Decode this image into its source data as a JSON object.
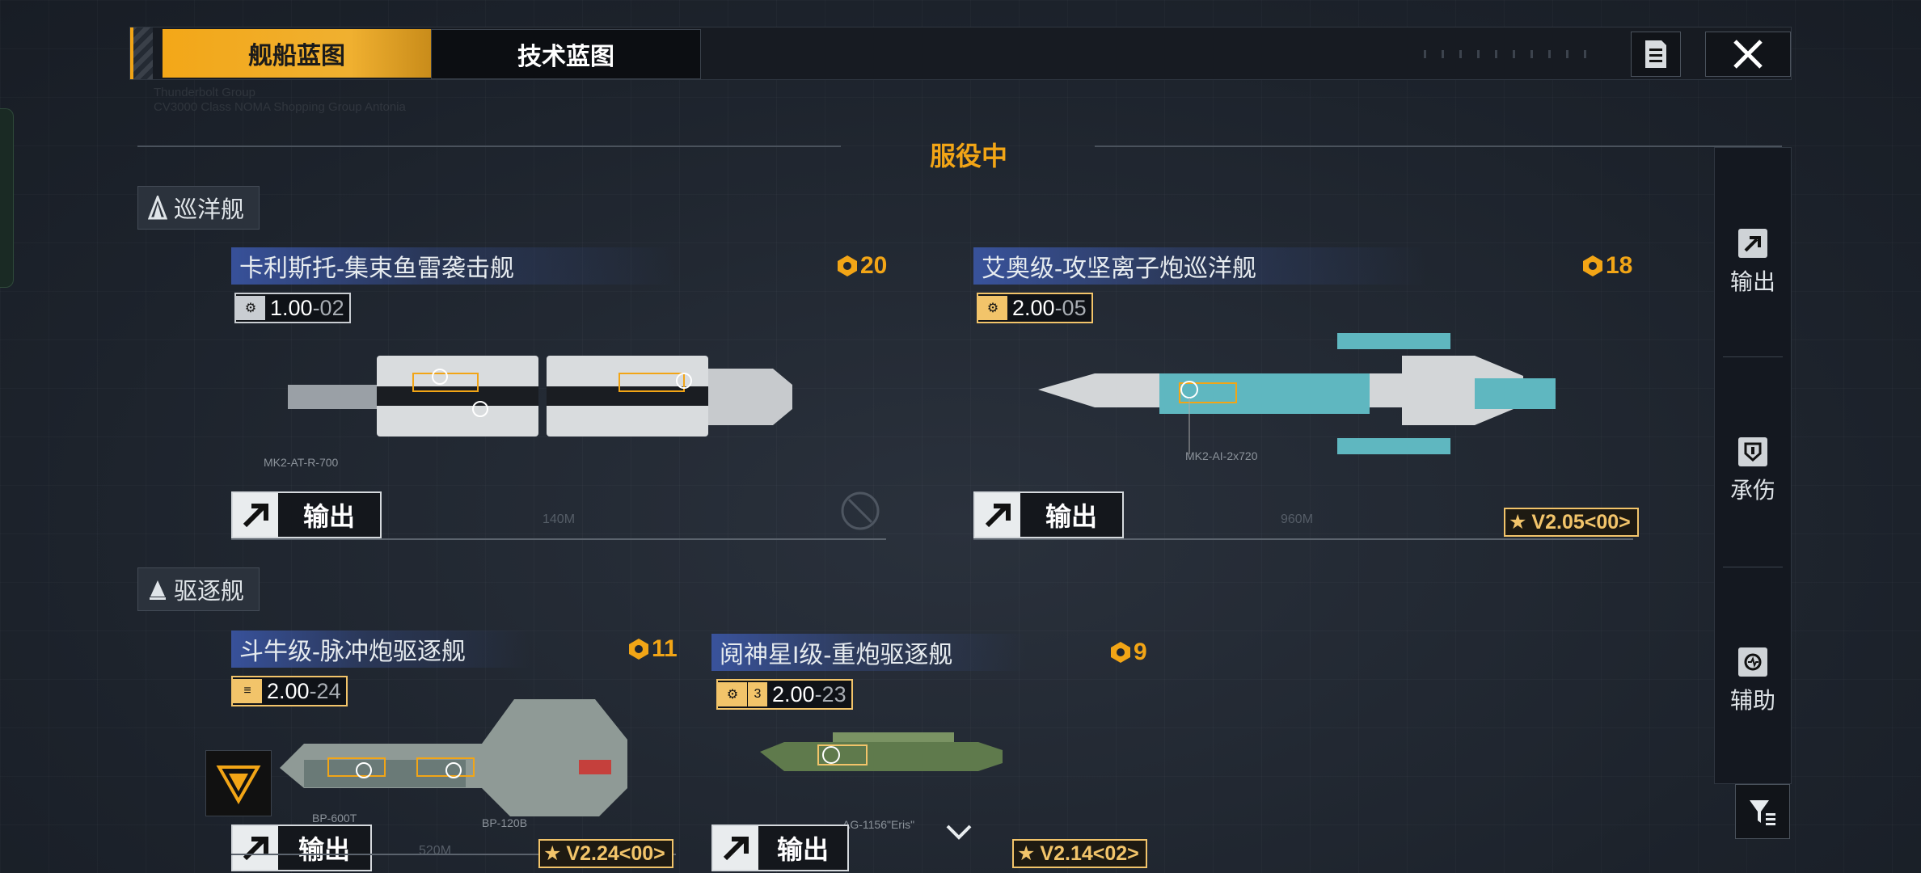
{
  "tabs": {
    "ship_blueprints": "舰船蓝图",
    "tech_blueprints": "技术蓝图"
  },
  "section": {
    "title": "服役中"
  },
  "categories": {
    "cruiser": "巡洋舰",
    "destroyer": "驱逐舰"
  },
  "ships": [
    {
      "name": "卡利斯托-集束鱼雷袭击舰",
      "cost": "20",
      "version_main": "1.00",
      "version_sub": "-02",
      "output": "输出",
      "scale": "140M",
      "weapon": "MK2-AT-R-700"
    },
    {
      "name": "艾奥级-攻坚离子炮巡洋舰",
      "cost": "18",
      "version_main": "2.00",
      "version_sub": "-05",
      "output": "输出",
      "scale": "960M",
      "tag": "V2.05<00>",
      "weapon": "MK2-AI-2x720"
    },
    {
      "name": "斗牛级-脉冲炮驱逐舰",
      "cost": "11",
      "version_main": "2.00",
      "version_sub": "-24",
      "output": "输出",
      "scale": "520M",
      "tag": "V2.24<00>",
      "weapon1": "BP-600T",
      "weapon2": "BP-120B"
    },
    {
      "name": "阋神星I级-重炮驱逐舰",
      "cost": "9",
      "version_prefix": "3",
      "version_main": "2.00",
      "version_sub": "-23",
      "output": "输出",
      "tag": "V2.14<02>",
      "weapon": "AG-1156\"Eris\""
    }
  ],
  "right_panel": {
    "output": "输出",
    "tank": "承伤",
    "support": "辅助"
  },
  "colors": {
    "accent": "#f2a516",
    "name_bar": "#4060be",
    "panel": "#141820"
  }
}
